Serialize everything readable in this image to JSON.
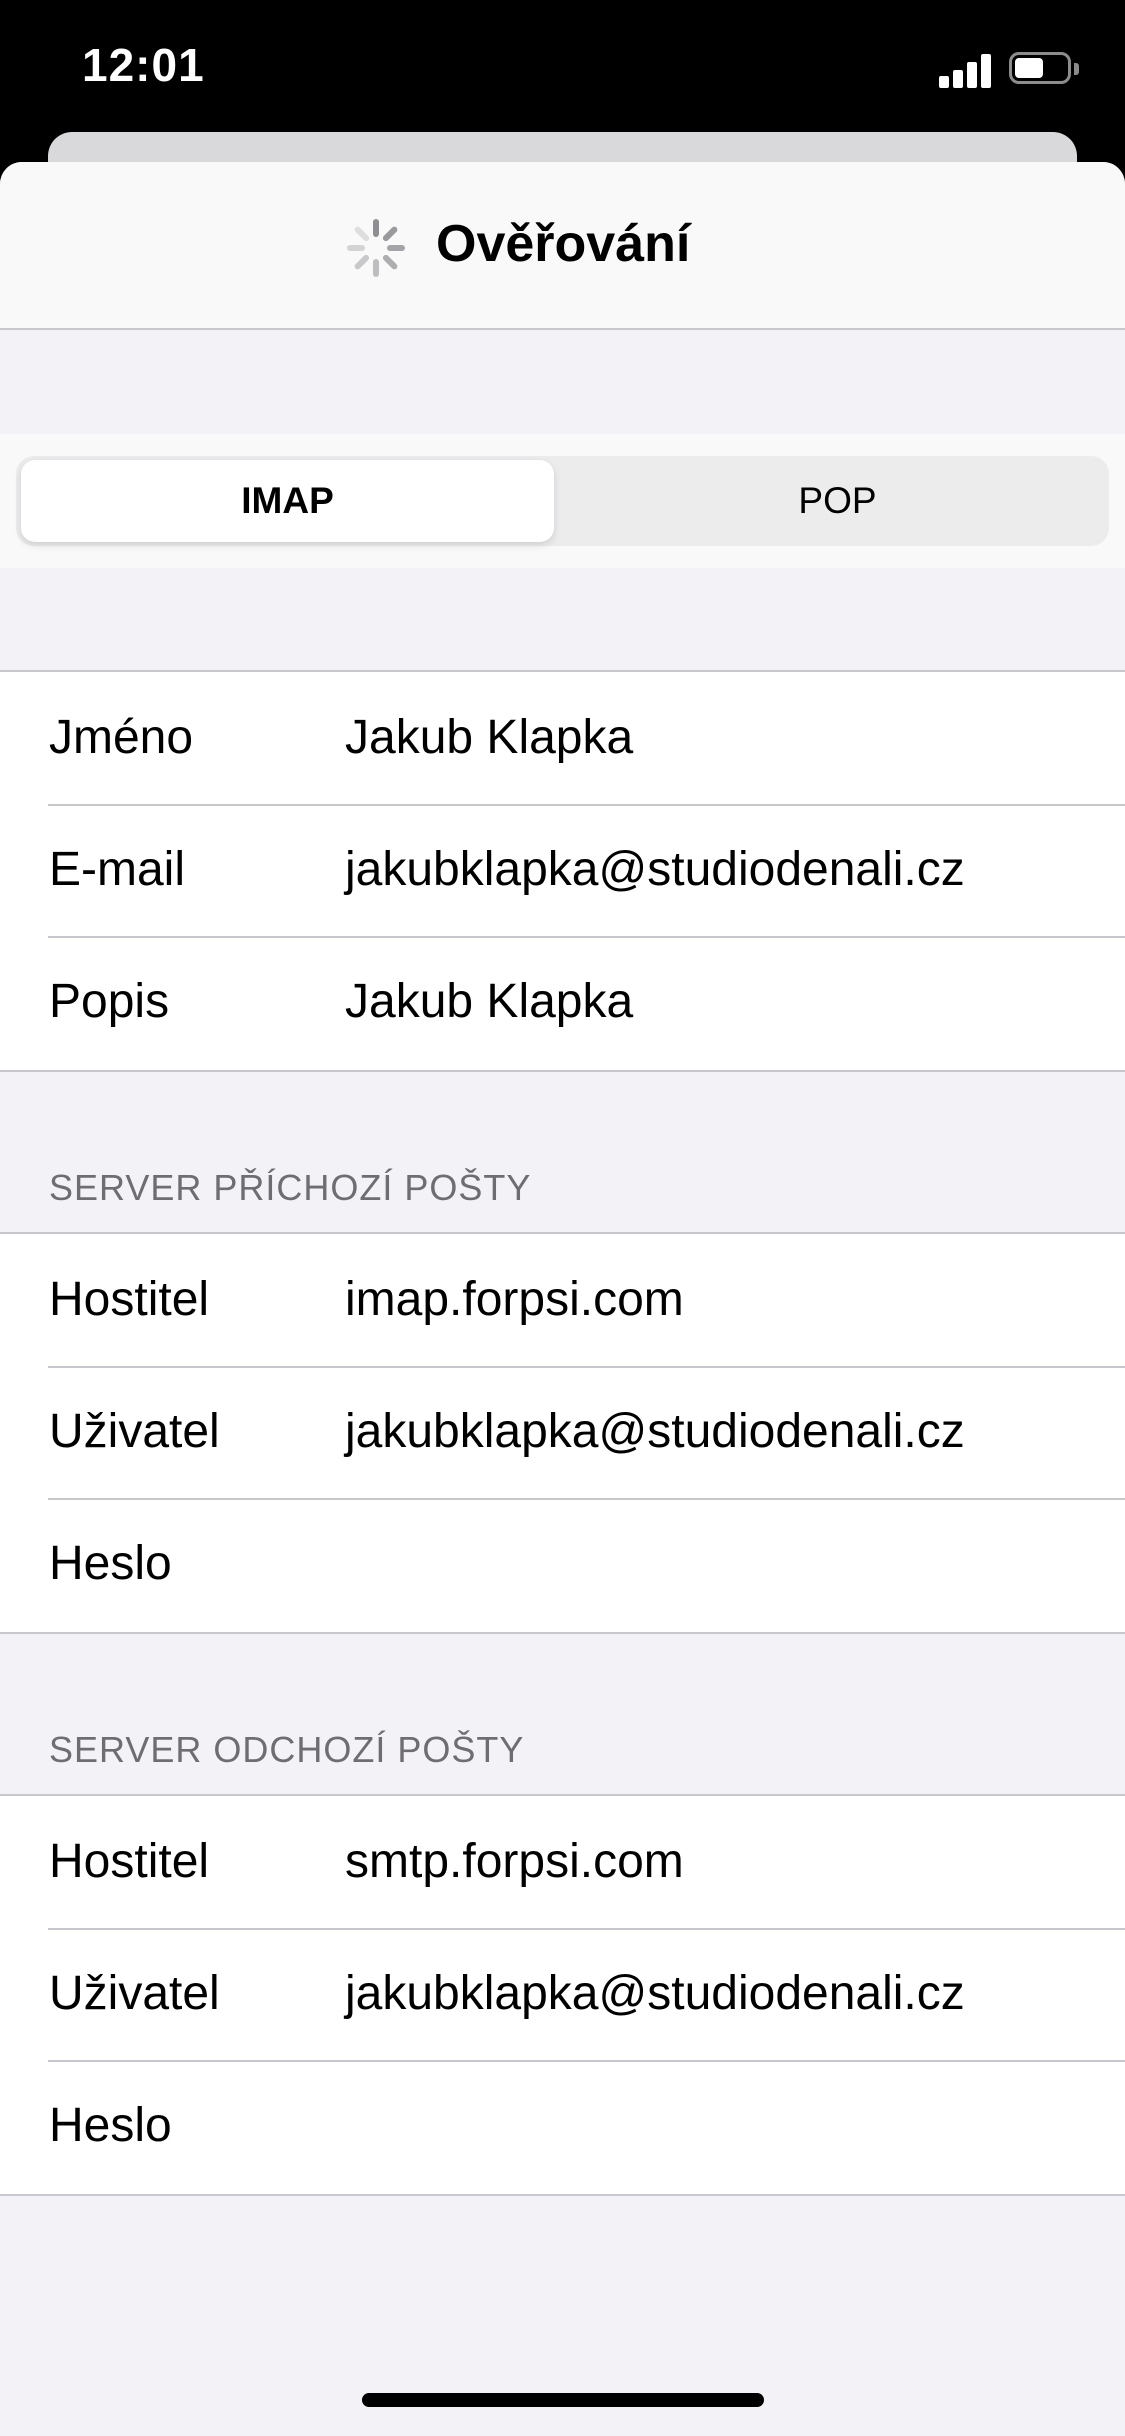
{
  "status_bar": {
    "time": "12:01",
    "signal_icon": "cellular-signal-icon",
    "battery_icon": "battery-icon",
    "battery_level": 0.55
  },
  "nav": {
    "title": "Ověřování",
    "spinner_icon": "activity-spinner-icon"
  },
  "segmented": {
    "options": [
      "IMAP",
      "POP"
    ],
    "selected": "IMAP"
  },
  "account": {
    "rows": [
      {
        "label": "Jméno",
        "value": "Jakub Klapka"
      },
      {
        "label": "E-mail",
        "value": "jakubklapka@studiodenali.cz"
      },
      {
        "label": "Popis",
        "value": "Jakub Klapka"
      }
    ]
  },
  "incoming": {
    "header": "SERVER PŘÍCHOZÍ POŠTY",
    "rows": [
      {
        "label": "Hostitel",
        "value": "imap.forpsi.com"
      },
      {
        "label": "Uživatel",
        "value": "jakubklapka@studiodenali.cz"
      },
      {
        "label": "Heslo",
        "value": ""
      }
    ]
  },
  "outgoing": {
    "header": "SERVER ODCHOZÍ POŠTY",
    "rows": [
      {
        "label": "Hostitel",
        "value": "smtp.forpsi.com"
      },
      {
        "label": "Uživatel",
        "value": "jakubklapka@studiodenali.cz"
      },
      {
        "label": "Heslo",
        "value": ""
      }
    ]
  }
}
